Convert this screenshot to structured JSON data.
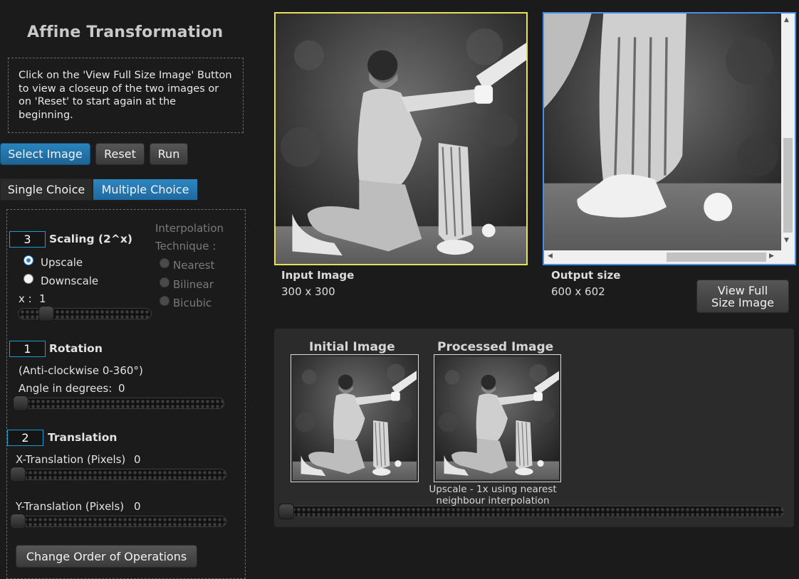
{
  "header": {
    "title": "Affine Transformation"
  },
  "help": {
    "text": "Click on the 'View Full Size Image' Button to view a closeup of the two images or on 'Reset' to start again at the beginning."
  },
  "toolbar": {
    "select_label": "Select Image",
    "reset_label": "Reset",
    "run_label": "Run"
  },
  "tabs": [
    {
      "label": "Single Choice",
      "active": false
    },
    {
      "label": "Multiple Choice",
      "active": true
    }
  ],
  "scaling": {
    "order": "3",
    "title": "Scaling (2^x)",
    "upscale_label": "Upscale",
    "downscale_label": "Downscale",
    "selected": "Upscale",
    "x_label": "x :",
    "x_value": "1"
  },
  "interpolation": {
    "title_line1": "Interpolation",
    "title_line2": "Technique :",
    "options": [
      "Nearest",
      "Bilinear",
      "Bicubic"
    ],
    "enabled": false
  },
  "rotation": {
    "order": "1",
    "title": "Rotation",
    "hint": "(Anti-clockwise 0-360°)",
    "angle_label": "Angle in degrees:",
    "angle_value": "0"
  },
  "translation": {
    "order": "2",
    "title": "Translation",
    "x_label": "X-Translation (Pixels)",
    "x_value": "0",
    "y_label": "Y-Translation (Pixels)",
    "y_value": "0"
  },
  "change_order_label": "Change Order of Operations",
  "input_image": {
    "label": "Input Image",
    "size": "300 x 300"
  },
  "output_image": {
    "label": "Output size",
    "size": "600 x 602"
  },
  "view_full_label_1": "View Full",
  "view_full_label_2": "Size Image",
  "comparison": {
    "initial_label": "Initial Image",
    "processed_label": "Processed Image",
    "caption_line1": "Upscale - 1x using nearest",
    "caption_line2": "neighbour interpolation"
  },
  "colors": {
    "accent": "#1d6aa0",
    "numbox_border": "#1e9ccf",
    "input_frame": "#e6e05a",
    "output_frame": "#4a90e2"
  }
}
